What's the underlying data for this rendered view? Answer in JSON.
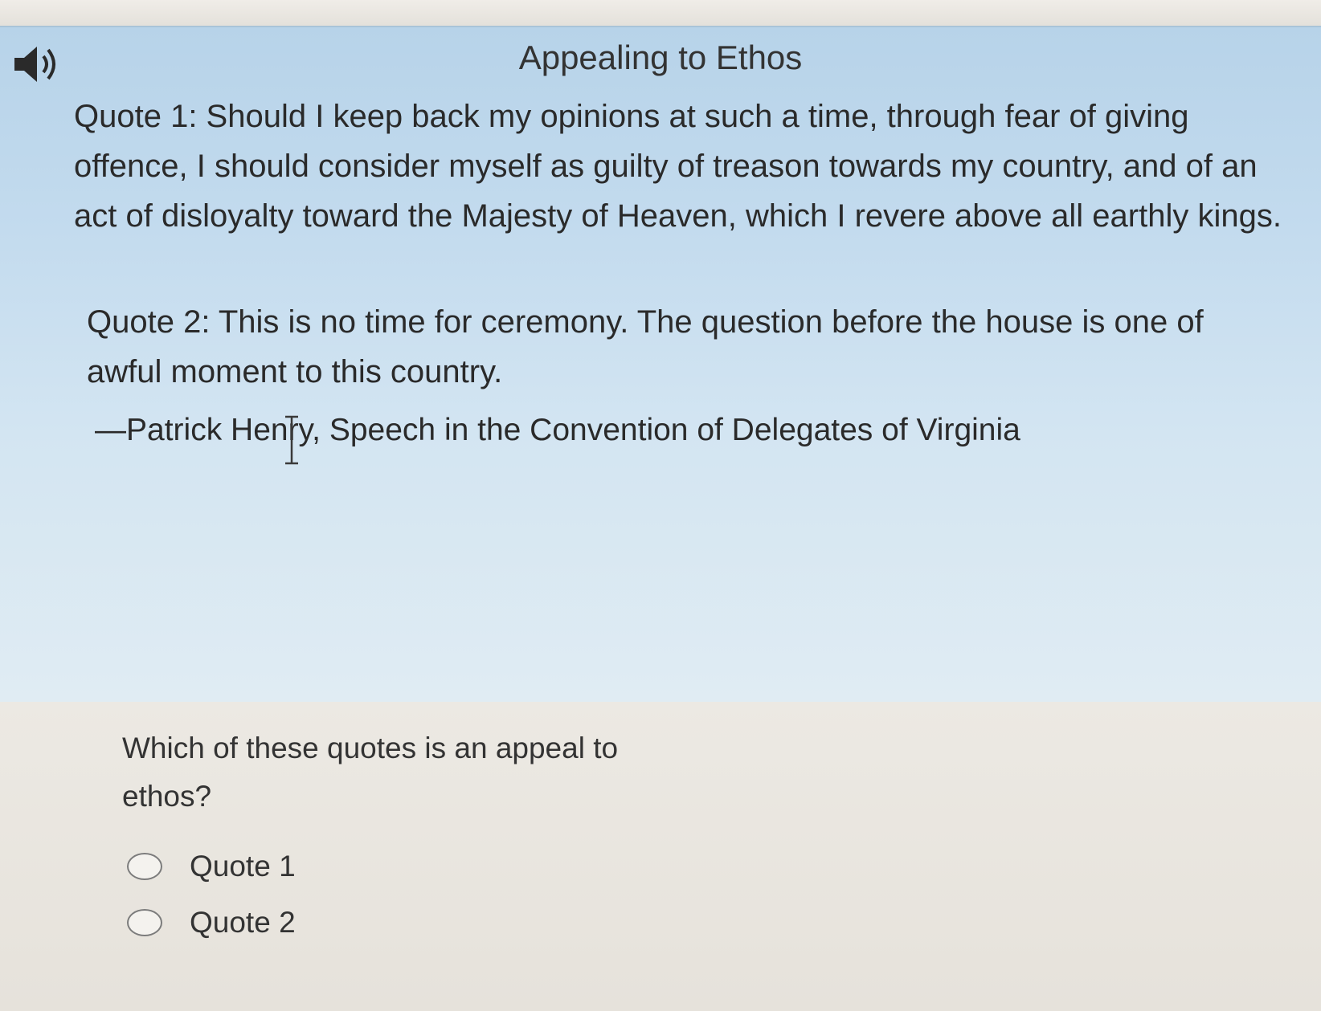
{
  "header": {
    "title": "Appealing to Ethos",
    "audio_icon": "speaker-icon"
  },
  "passage": {
    "quote1": "Quote 1: Should I keep back my opinions at such a time, through fear of giving offence, I should consider myself as guilty of treason towards my country, and of an act of disloyalty toward the Majesty of Heaven, which I revere above all earthly kings.",
    "quote2": "Quote 2: This is no time for ceremony. The question before the house is one of awful moment to this country.",
    "attribution": "—Patrick Henry, Speech in the Convention of Delegates of Virginia"
  },
  "question": {
    "prompt": "Which of these quotes is an appeal to ethos?",
    "options": [
      {
        "label": "Quote 1",
        "selected": false
      },
      {
        "label": "Quote 2",
        "selected": false
      }
    ]
  },
  "colors": {
    "passage_background": "#c3dbee",
    "question_background": "#e7e4dd",
    "text": "#2b2b2b"
  }
}
